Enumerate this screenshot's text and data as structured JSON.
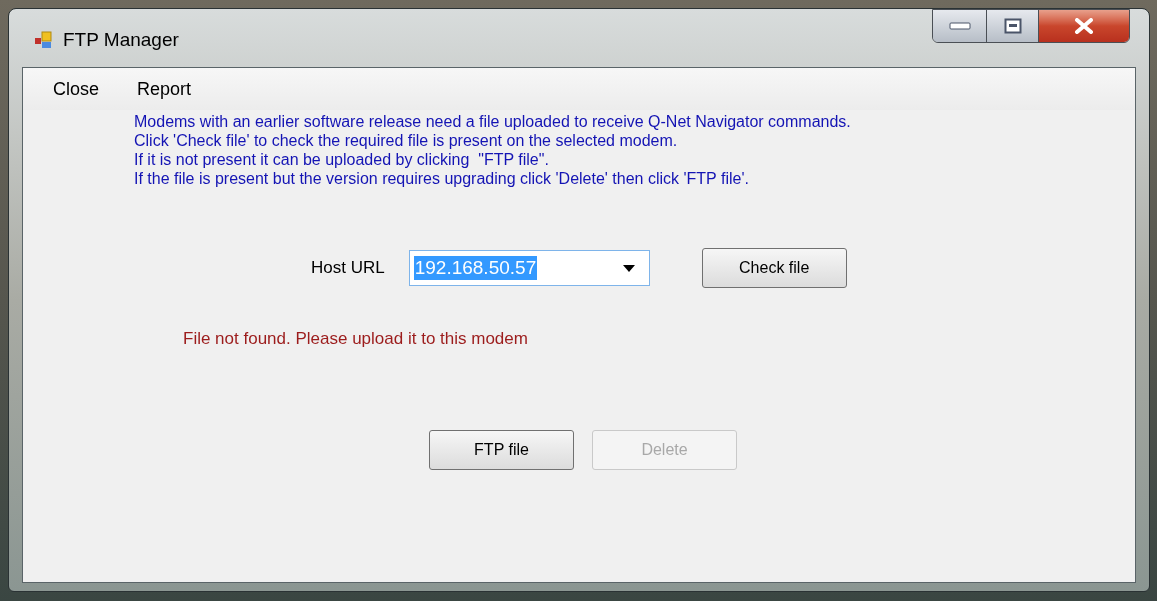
{
  "window": {
    "title": "FTP Manager"
  },
  "menu": [
    {
      "label": "Close"
    },
    {
      "label": "Report"
    }
  ],
  "instructions": [
    "Modems with an earlier software release need a file uploaded to receive Q-Net Navigator commands.",
    "Click 'Check file' to check the required file is present on the selected modem.",
    "If it is not present it can be uploaded by clicking  \"FTP file\".",
    "If the file is present but the version requires upgrading click 'Delete' then click 'FTP file'."
  ],
  "host": {
    "label": "Host URL",
    "value": "192.168.50.57",
    "text_highlighted": true
  },
  "check_button": {
    "label": "Check file",
    "disabled": false
  },
  "status_message": "File not found. Please upload it to this modem",
  "buttons": [
    {
      "label": "FTP file",
      "disabled": false
    },
    {
      "label": "Delete",
      "disabled": true
    }
  ]
}
